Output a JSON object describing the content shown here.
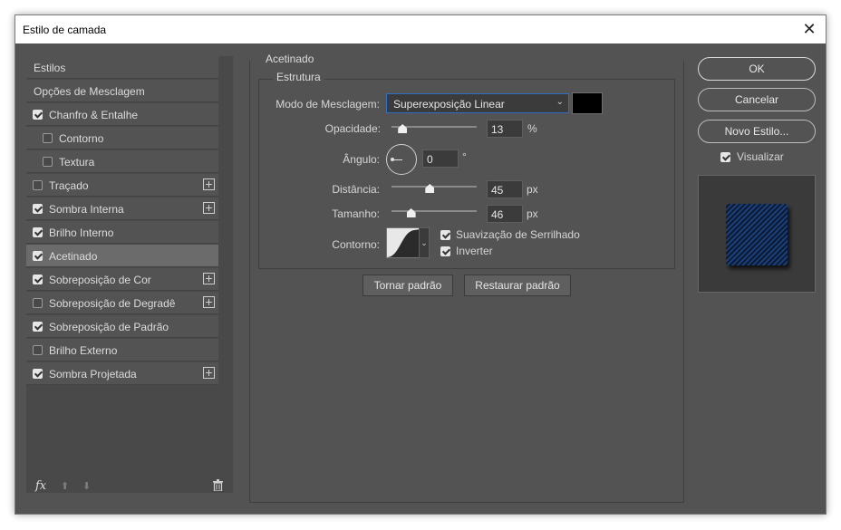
{
  "window": {
    "title": "Estilo de camada",
    "close_glyph": "✕"
  },
  "sidebar": {
    "items": [
      {
        "label": "Estilos",
        "checkbox": null,
        "plus": false,
        "active": false,
        "indent": 0
      },
      {
        "label": "Opções de Mesclagem",
        "checkbox": null,
        "plus": false,
        "active": false,
        "indent": 0
      },
      {
        "label": "Chanfro & Entalhe",
        "checkbox": true,
        "plus": false,
        "active": false,
        "indent": 0
      },
      {
        "label": "Contorno",
        "checkbox": false,
        "plus": false,
        "active": false,
        "indent": 1
      },
      {
        "label": "Textura",
        "checkbox": false,
        "plus": false,
        "active": false,
        "indent": 1
      },
      {
        "label": "Traçado",
        "checkbox": false,
        "plus": true,
        "active": false,
        "indent": 0
      },
      {
        "label": "Sombra Interna",
        "checkbox": true,
        "plus": true,
        "active": false,
        "indent": 0
      },
      {
        "label": "Brilho Interno",
        "checkbox": true,
        "plus": false,
        "active": false,
        "indent": 0
      },
      {
        "label": "Acetinado",
        "checkbox": true,
        "plus": false,
        "active": true,
        "indent": 0
      },
      {
        "label": "Sobreposição de Cor",
        "checkbox": true,
        "plus": true,
        "active": false,
        "indent": 0
      },
      {
        "label": "Sobreposição de Degradê",
        "checkbox": false,
        "plus": true,
        "active": false,
        "indent": 0
      },
      {
        "label": "Sobreposição de Padrão",
        "checkbox": true,
        "plus": false,
        "active": false,
        "indent": 0
      },
      {
        "label": "Brilho Externo",
        "checkbox": false,
        "plus": false,
        "active": false,
        "indent": 0
      },
      {
        "label": "Sombra Projetada",
        "checkbox": true,
        "plus": true,
        "active": false,
        "indent": 0
      }
    ],
    "footer": {
      "fx_label": "fx",
      "up_glyph": "⬆",
      "down_glyph": "⬇",
      "trash_glyph": "🗑"
    }
  },
  "satin": {
    "section_title": "Acetinado",
    "group_title": "Estrutura",
    "blend_mode_label": "Modo de Mesclagem:",
    "blend_mode_value": "Superexposição Linear",
    "blend_color": "#000000",
    "opacity_label": "Opacidade:",
    "opacity_value": "13",
    "opacity_unit": "%",
    "opacity_fraction": 0.13,
    "angle_label": "Ângulo:",
    "angle_value": "0",
    "angle_unit": "°",
    "distance_label": "Distância:",
    "distance_value": "45",
    "distance_unit": "px",
    "distance_fraction": 0.45,
    "size_label": "Tamanho:",
    "size_value": "46",
    "size_unit": "px",
    "size_fraction": 0.23,
    "contour_label": "Contorno:",
    "antialias_label": "Suavização de Serrilhado",
    "antialias_checked": true,
    "invert_label": "Inverter",
    "invert_checked": true,
    "make_default_label": "Tornar padrão",
    "reset_default_label": "Restaurar padrão"
  },
  "actions": {
    "ok_label": "OK",
    "cancel_label": "Cancelar",
    "new_style_label": "Novo Estilo...",
    "preview_label": "Visualizar",
    "preview_checked": true
  }
}
